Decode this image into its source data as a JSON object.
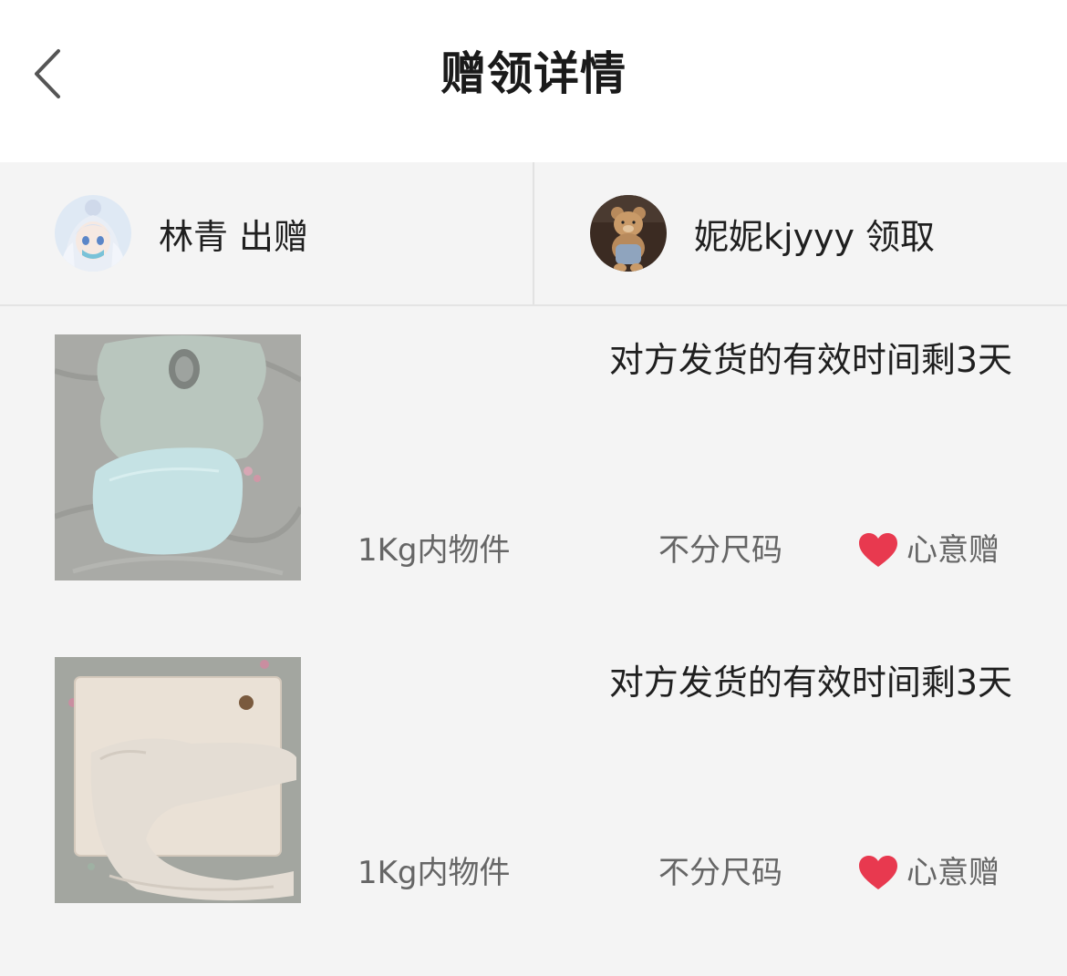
{
  "header": {
    "title": "赠领详情",
    "back_icon": "chevron-left-icon"
  },
  "parties": {
    "giver": {
      "name": "林青",
      "action": "出赠",
      "avatar": "anime-character-avatar"
    },
    "receiver": {
      "name": "妮妮kjyyy",
      "action": "领取",
      "avatar": "teddy-bear-avatar"
    }
  },
  "items": [
    {
      "deadline": "对方发货的有效时间剩3天",
      "weight": "1Kg内物件",
      "size": "不分尺码",
      "gift_type": "心意赠",
      "image": "baby-shaping-pillow-green"
    },
    {
      "deadline": "对方发货的有效时间剩3天",
      "weight": "1Kg内物件",
      "size": "不分尺码",
      "gift_type": "心意赠",
      "image": "nursing-pillow-cream"
    }
  ],
  "colors": {
    "heart": "#e8394f",
    "background": "#f4f4f4",
    "header_bg": "#ffffff"
  }
}
